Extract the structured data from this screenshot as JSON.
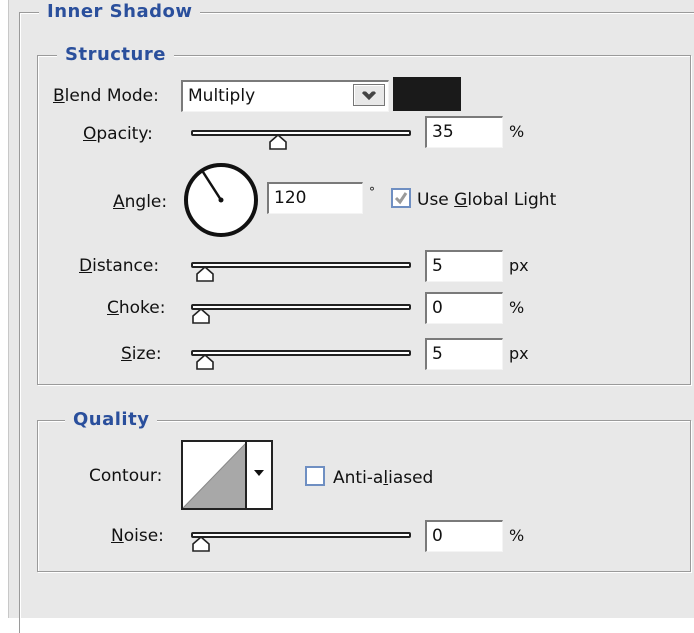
{
  "inner_shadow": {
    "title": "Inner Shadow",
    "structure": {
      "title": "Structure",
      "blend_mode": {
        "label_first": "B",
        "label_rest": "lend Mode:",
        "value": "Multiply",
        "color": "#1a1a1a"
      },
      "opacity": {
        "label_first": "O",
        "label_rest": "pacity:",
        "value": "35",
        "unit": "%",
        "level": 0.35
      },
      "angle": {
        "label_first": "A",
        "label_rest": "ngle:",
        "value": "120",
        "unit": "°"
      },
      "use_global_light": {
        "pre": "Use ",
        "accel": "G",
        "rest": "lobal Light",
        "checked": true
      },
      "distance": {
        "label_first": "D",
        "label_rest": "istance:",
        "value": "5",
        "unit": "px",
        "level": 0.02
      },
      "choke": {
        "label_first": "C",
        "label_rest": "hoke:",
        "value": "0",
        "unit": "%",
        "level": 0.0
      },
      "size": {
        "label_first": "S",
        "label_rest": "ize:",
        "value": "5",
        "unit": "px",
        "level": 0.02
      }
    },
    "quality": {
      "title": "Quality",
      "contour": {
        "label": "Contour:"
      },
      "anti_aliased": {
        "pre": "Anti-a",
        "accel": "l",
        "rest": "iased",
        "checked": false
      },
      "noise": {
        "label_first": "N",
        "label_rest": "oise:",
        "value": "0",
        "unit": "%",
        "level": 0.0
      }
    }
  }
}
